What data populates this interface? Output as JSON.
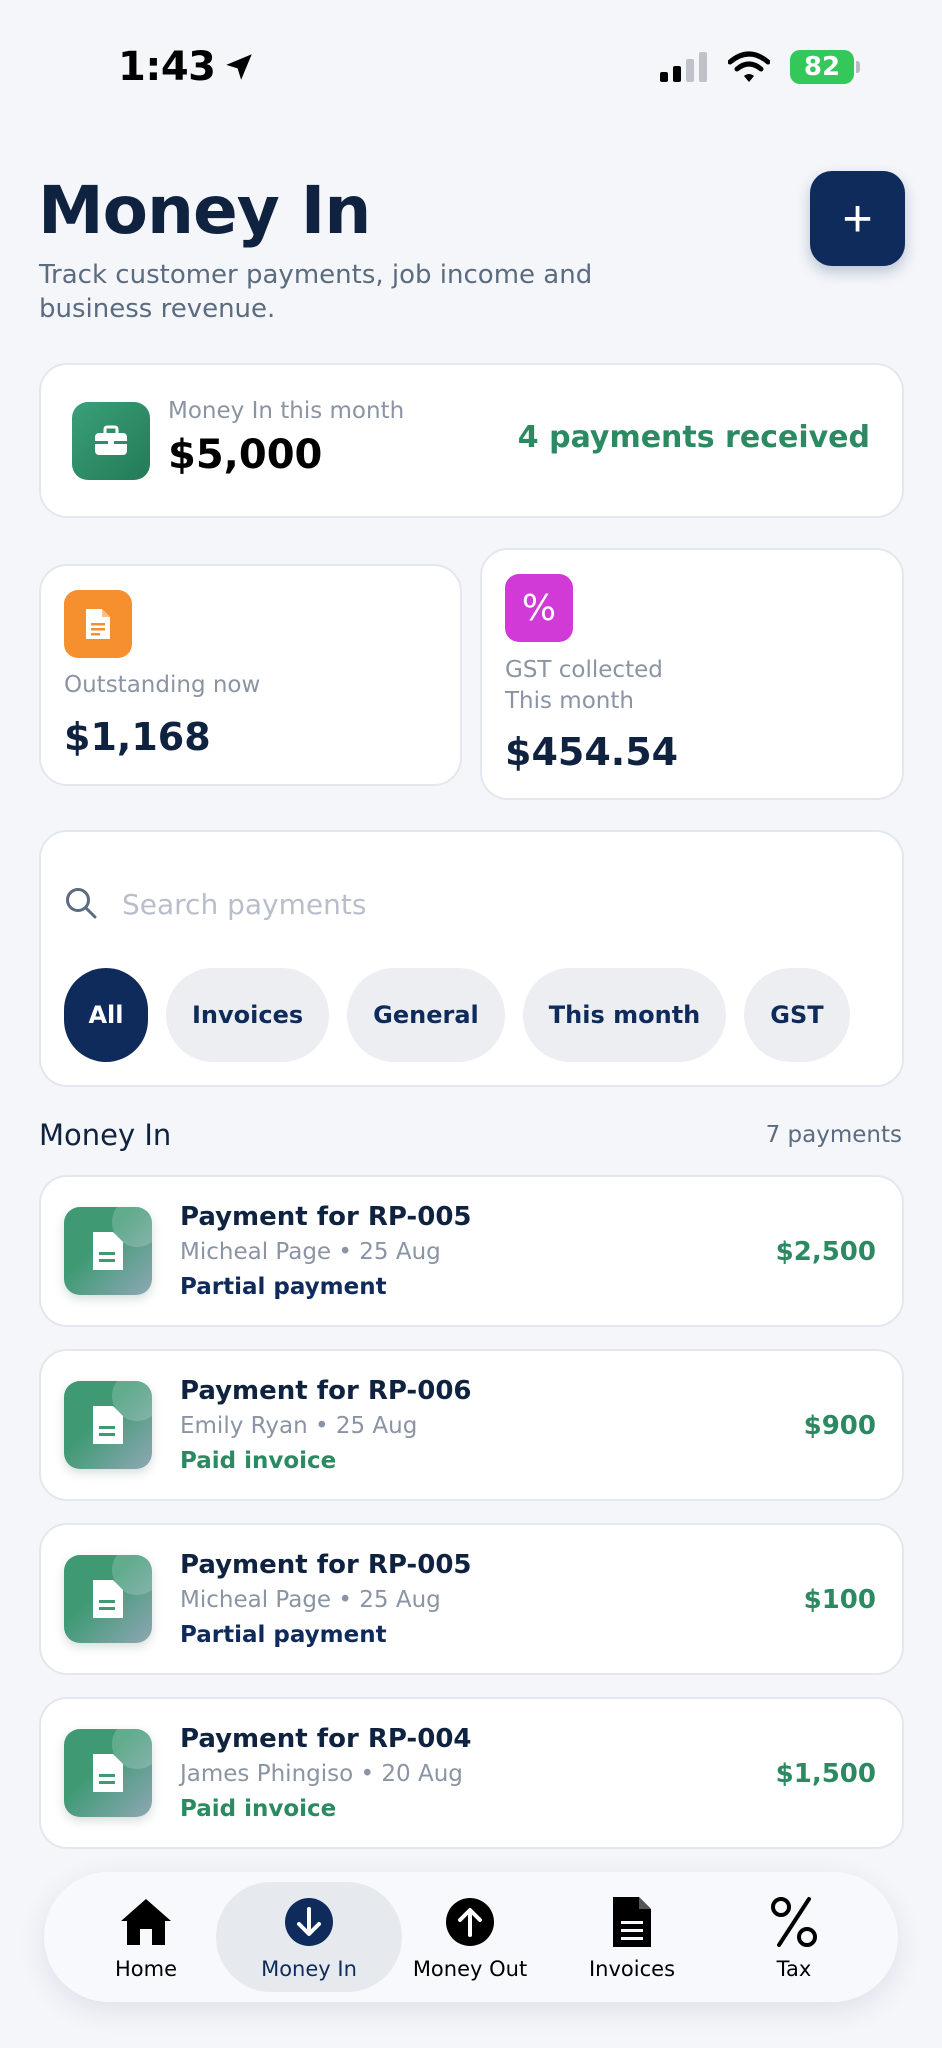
{
  "status_bar": {
    "time": "1:43",
    "battery": "82"
  },
  "header": {
    "title": "Money In",
    "subtitle": "Track customer payments, job income and business revenue.",
    "add_label": "+"
  },
  "summary": {
    "label": "Money In this month",
    "value": "$5,000",
    "badge": "4 payments received",
    "icon": "briefcase-icon"
  },
  "stats": [
    {
      "label": "Outstanding now",
      "value": "$1,168",
      "icon": "document-icon",
      "color": "#f6902f"
    },
    {
      "label": "GST collected",
      "sublabel": "This month",
      "value": "$454.54",
      "icon_text": "%",
      "color": "#d23ad8"
    }
  ],
  "search": {
    "placeholder": "Search payments",
    "value": ""
  },
  "filters": [
    "All",
    "Invoices",
    "General",
    "This month",
    "GST"
  ],
  "active_filter": "All",
  "list": {
    "title": "Money In",
    "count": "7 payments",
    "items": [
      {
        "title": "Payment for RP-005",
        "customer": "Micheal Page",
        "date": "25 Aug",
        "status": "Partial payment",
        "amount": "$2,500"
      },
      {
        "title": "Payment for RP-006",
        "customer": "Emily Ryan",
        "date": "25 Aug",
        "status": "Paid invoice",
        "amount": "$900"
      },
      {
        "title": "Payment for RP-005",
        "customer": "Micheal Page",
        "date": "25 Aug",
        "status": "Partial payment",
        "amount": "$100"
      },
      {
        "title": "Payment for RP-004",
        "customer": "James Phingiso",
        "date": "20 Aug",
        "status": "Paid invoice",
        "amount": "$1,500"
      }
    ]
  },
  "nav": [
    {
      "label": "Home",
      "icon": "home-icon"
    },
    {
      "label": "Money In",
      "icon": "arrow-down-circle-icon",
      "active": true
    },
    {
      "label": "Money Out",
      "icon": "arrow-up-circle-icon"
    },
    {
      "label": "Invoices",
      "icon": "document-icon"
    },
    {
      "label": "Tax",
      "icon": "percent-icon"
    }
  ],
  "colors": {
    "navy": "#0f2b5b",
    "green": "#2b8a61",
    "background": "#f4f6fa"
  }
}
